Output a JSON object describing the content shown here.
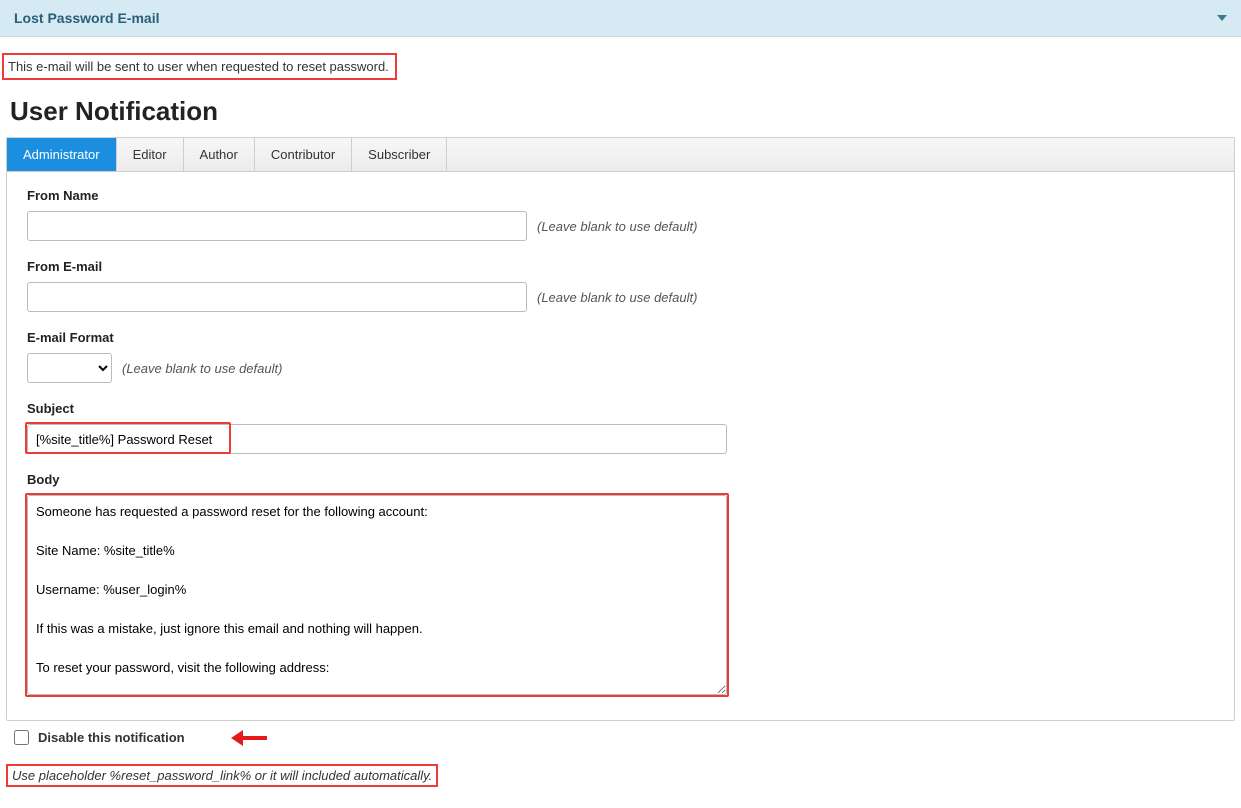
{
  "panel": {
    "title": "Lost Password E-mail",
    "description": "This e-mail will be sent to user when requested to reset password."
  },
  "section_heading": "User Notification",
  "tabs": [
    {
      "label": "Administrator",
      "active": true
    },
    {
      "label": "Editor",
      "active": false
    },
    {
      "label": "Author",
      "active": false
    },
    {
      "label": "Contributor",
      "active": false
    },
    {
      "label": "Subscriber",
      "active": false
    }
  ],
  "fields": {
    "from_name": {
      "label": "From Name",
      "value": "",
      "hint": "(Leave blank to use default)"
    },
    "from_email": {
      "label": "From E-mail",
      "value": "",
      "hint": "(Leave blank to use default)"
    },
    "email_format": {
      "label": "E-mail Format",
      "value": "",
      "hint": "(Leave blank to use default)"
    },
    "subject": {
      "label": "Subject",
      "value": "[%site_title%] Password Reset"
    },
    "body": {
      "label": "Body",
      "value": "Someone has requested a password reset for the following account:\n\nSite Name: %site_title%\n\nUsername: %user_login%\n\nIf this was a mistake, just ignore this email and nothing will happen.\n\nTo reset your password, visit the following address:"
    }
  },
  "disable": {
    "label": "Disable this notification",
    "checked": false
  },
  "placeholder_note": "Use placeholder %reset_password_link% or it will included automatically."
}
